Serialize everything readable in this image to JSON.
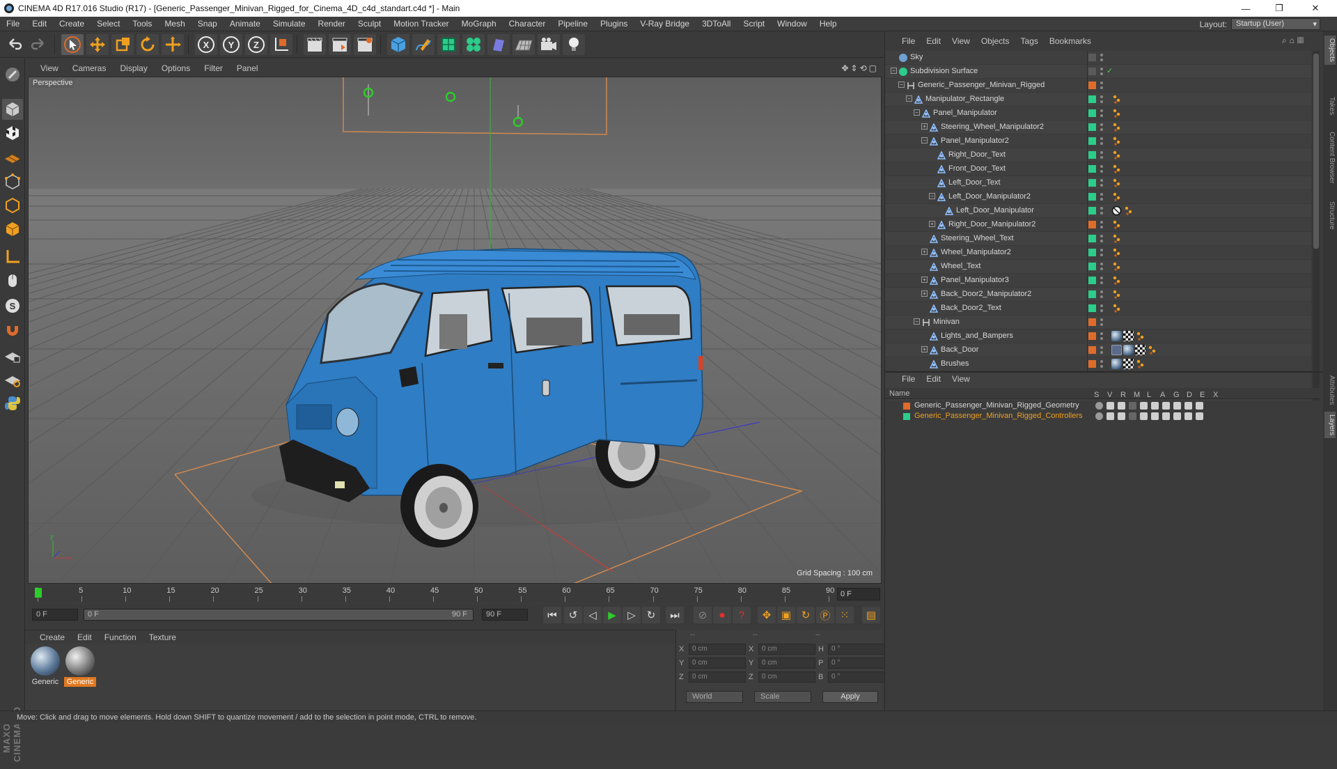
{
  "window": {
    "title": "CINEMA 4D R17.016 Studio (R17) - [Generic_Passenger_Minivan_Rigged_for_Cinema_4D_c4d_standart.c4d *] - Main",
    "minimize": "—",
    "maximize": "❐",
    "close": "✕"
  },
  "menubar": [
    "File",
    "Edit",
    "Create",
    "Select",
    "Tools",
    "Mesh",
    "Snap",
    "Animate",
    "Simulate",
    "Render",
    "Sculpt",
    "Motion Tracker",
    "MoGraph",
    "Character",
    "Pipeline",
    "Plugins",
    "V-Ray Bridge",
    "3DToAll",
    "Script",
    "Window",
    "Help"
  ],
  "layout": {
    "label": "Layout:",
    "value": "Startup (User)"
  },
  "viewport": {
    "menu": [
      "View",
      "Cameras",
      "Display",
      "Options",
      "Filter",
      "Panel"
    ],
    "label": "Perspective",
    "grid_spacing": "Grid Spacing : 100 cm",
    "nav_icons": "✥⇕⟲▢"
  },
  "timeline": {
    "ticks": [
      "0",
      "5",
      "10",
      "15",
      "20",
      "25",
      "30",
      "35",
      "40",
      "45",
      "50",
      "55",
      "60",
      "65",
      "70",
      "75",
      "80",
      "85",
      "90"
    ],
    "current_frame": "0 F",
    "start_field": "0 F",
    "range_start": "0 F",
    "range_end": "90 F",
    "end_field": "90 F"
  },
  "material_manager": {
    "menu": [
      "Create",
      "Edit",
      "Function",
      "Texture"
    ],
    "materials": [
      {
        "label": "Generic",
        "selected": false
      },
      {
        "label": "Generic",
        "selected": true
      }
    ]
  },
  "coordinates": {
    "header": [
      "--",
      "--",
      "--"
    ],
    "rows": [
      {
        "a": "X",
        "av": "0 cm",
        "b": "X",
        "bv": "0 cm",
        "c": "H",
        "cv": "0 °"
      },
      {
        "a": "Y",
        "av": "0 cm",
        "b": "Y",
        "bv": "0 cm",
        "c": "P",
        "cv": "0 °"
      },
      {
        "a": "Z",
        "av": "0 cm",
        "b": "Z",
        "bv": "0 cm",
        "c": "B",
        "cv": "0 °"
      }
    ],
    "world": "World",
    "scale": "Scale",
    "apply": "Apply"
  },
  "object_manager": {
    "menu": [
      "File",
      "Edit",
      "View",
      "Objects",
      "Tags",
      "Bookmarks"
    ],
    "objects": [
      {
        "name": "Sky",
        "depth": 0,
        "icon": "sky-icon",
        "exp": "",
        "layer": "#5a5a5a",
        "tags": []
      },
      {
        "name": "Subdivision Surface",
        "depth": 0,
        "icon": "subdivision-icon",
        "exp": "−",
        "layer": "#5a5a5a",
        "tags": [],
        "check": "✓"
      },
      {
        "name": "Generic_Passenger_Minivan_Rigged",
        "depth": 1,
        "icon": "null-icon",
        "exp": "−",
        "layer": "#e06c2a",
        "tags": []
      },
      {
        "name": "Manipulator_Rectangle",
        "depth": 2,
        "icon": "joint-icon",
        "exp": "−",
        "layer": "#2ccc8a",
        "tags": [
          "dots"
        ]
      },
      {
        "name": "Panel_Manipulator",
        "depth": 3,
        "icon": "joint-icon",
        "exp": "−",
        "layer": "#2ccc8a",
        "tags": [
          "dots"
        ]
      },
      {
        "name": "Steering_Wheel_Manipulator2",
        "depth": 4,
        "icon": "joint-icon",
        "exp": "+",
        "layer": "#2ccc8a",
        "tags": [
          "dots"
        ]
      },
      {
        "name": "Panel_Manipulator2",
        "depth": 4,
        "icon": "joint-icon",
        "exp": "−",
        "layer": "#2ccc8a",
        "tags": [
          "dots"
        ]
      },
      {
        "name": "Right_Door_Text",
        "depth": 5,
        "icon": "joint-icon",
        "exp": "",
        "layer": "#2ccc8a",
        "tags": [
          "dots"
        ]
      },
      {
        "name": "Front_Door_Text",
        "depth": 5,
        "icon": "joint-icon",
        "exp": "",
        "layer": "#2ccc8a",
        "tags": [
          "dots"
        ]
      },
      {
        "name": "Left_Door_Text",
        "depth": 5,
        "icon": "joint-icon",
        "exp": "",
        "layer": "#2ccc8a",
        "tags": [
          "dots"
        ]
      },
      {
        "name": "Left_Door_Manipulator2",
        "depth": 5,
        "icon": "joint-icon",
        "exp": "−",
        "layer": "#2ccc8a",
        "tags": [
          "dots"
        ]
      },
      {
        "name": "Left_Door_Manipulator",
        "depth": 6,
        "icon": "joint-icon",
        "exp": "",
        "layer": "#2ccc8a",
        "tags": [
          "no",
          "dots"
        ]
      },
      {
        "name": "Right_Door_Manipulator2",
        "depth": 5,
        "icon": "joint-icon",
        "exp": "+",
        "layer": "#e06c2a",
        "tags": [
          "dots"
        ]
      },
      {
        "name": "Steering_Wheel_Text",
        "depth": 4,
        "icon": "joint-icon",
        "exp": "",
        "layer": "#2ccc8a",
        "tags": [
          "dots"
        ]
      },
      {
        "name": "Wheel_Manipulator2",
        "depth": 4,
        "icon": "joint-icon",
        "exp": "+",
        "layer": "#2ccc8a",
        "tags": [
          "dots"
        ]
      },
      {
        "name": "Wheel_Text",
        "depth": 4,
        "icon": "joint-icon",
        "exp": "",
        "layer": "#2ccc8a",
        "tags": [
          "dots"
        ]
      },
      {
        "name": "Panel_Manipulator3",
        "depth": 4,
        "icon": "joint-icon",
        "exp": "+",
        "layer": "#2ccc8a",
        "tags": [
          "dots"
        ]
      },
      {
        "name": "Back_Door2_Manipulator2",
        "depth": 4,
        "icon": "joint-icon",
        "exp": "+",
        "layer": "#2ccc8a",
        "tags": [
          "dots"
        ]
      },
      {
        "name": "Back_Door2_Text",
        "depth": 4,
        "icon": "joint-icon",
        "exp": "",
        "layer": "#2ccc8a",
        "tags": [
          "dots"
        ]
      },
      {
        "name": "Minivan",
        "depth": 3,
        "icon": "null-icon",
        "exp": "−",
        "layer": "#e06c2a",
        "tags": []
      },
      {
        "name": "Lights_and_Bampers",
        "depth": 4,
        "icon": "joint-icon",
        "exp": "",
        "layer": "#e06c2a",
        "tags": [
          "mat",
          "checker",
          "dots"
        ]
      },
      {
        "name": "Back_Door",
        "depth": 4,
        "icon": "joint-icon",
        "exp": "+",
        "layer": "#e06c2a",
        "tags": [
          "uv",
          "mat",
          "checker",
          "dots"
        ]
      },
      {
        "name": "Brushes",
        "depth": 4,
        "icon": "joint-icon",
        "exp": "",
        "layer": "#e06c2a",
        "tags": [
          "mat",
          "checker",
          "dots"
        ]
      }
    ]
  },
  "layer_manager": {
    "menu": [
      "File",
      "Edit",
      "View"
    ],
    "header_name": "Name",
    "header_cols": [
      "S",
      "V",
      "R",
      "M",
      "L",
      "A",
      "G",
      "D",
      "E",
      "X"
    ],
    "layers": [
      {
        "name": "Generic_Passenger_Minivan_Rigged_Geometry",
        "color": "#e06c2a",
        "text_color": "#d8d8d8"
      },
      {
        "name": "Generic_Passenger_Minivan_Rigged_Controllers",
        "color": "#2ccc8a",
        "text_color": "#f0a020"
      }
    ]
  },
  "side_tabs": [
    "Objects",
    "Takes",
    "Content Browser",
    "Structure",
    "Attributes",
    "Layers"
  ],
  "status": "Move: Click and drag to move elements. Hold down SHIFT to quantize movement / add to the selection in point mode, CTRL to remove.",
  "maxon_logo": "MAXON CINEMA 4D",
  "colors": {
    "accent": "#e06c2a",
    "controller": "#2ccc8a",
    "van_blue": "#2f7dc4"
  }
}
